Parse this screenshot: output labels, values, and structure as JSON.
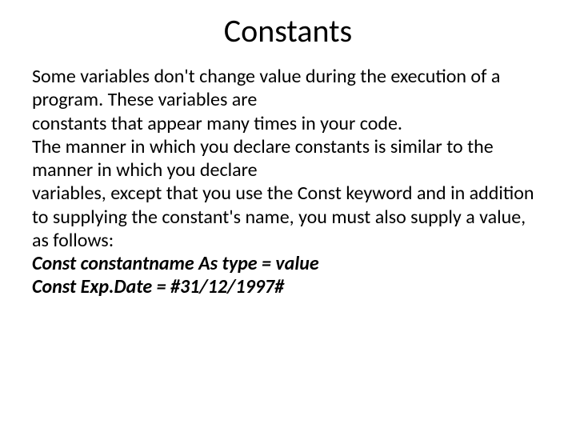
{
  "title": "Constants",
  "p1": "Some variables don't change value during the execution of a program. These variables are",
  "p2": "constants that appear many times in your code.",
  "p3": "The manner in which you declare constants is similar to the manner in which you declare",
  "p4": "variables, except that you use the Const  keyword and in addition to supplying the constant's name, you must also supply a value, as follows:",
  "code1": "Const constantname As type = value",
  "code2": "Const Exp.Date = #31/12/1997#"
}
